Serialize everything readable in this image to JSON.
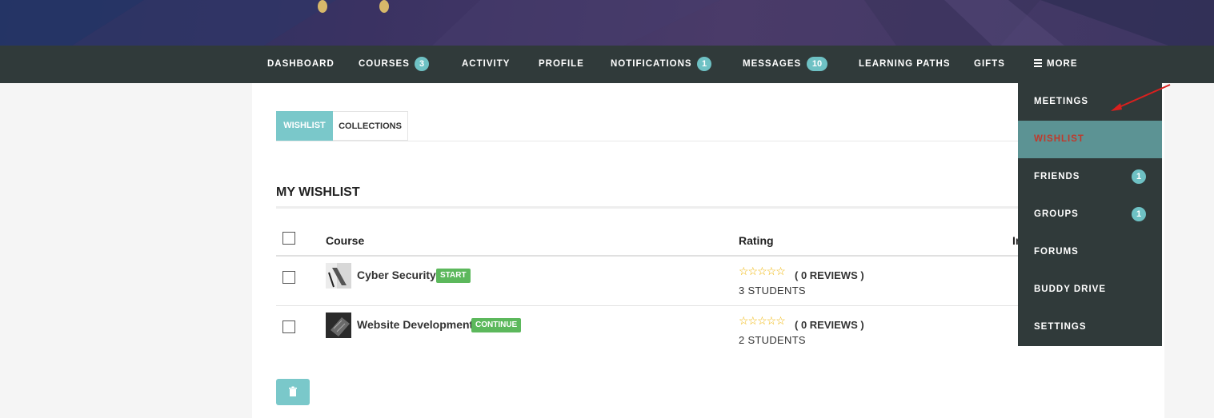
{
  "nav": {
    "items": [
      {
        "label": "DASHBOARD"
      },
      {
        "label": "COURSES",
        "badge": "3"
      },
      {
        "label": "ACTIVITY"
      },
      {
        "label": "PROFILE"
      },
      {
        "label": "NOTIFICATIONS",
        "badge": "1"
      },
      {
        "label": "MESSAGES",
        "badge": "10"
      },
      {
        "label": "LEARNING PATHS"
      },
      {
        "label": "GIFTS"
      },
      {
        "label": "MORE",
        "icon": "hamburger-icon"
      }
    ]
  },
  "dropdown": {
    "items": [
      {
        "label": "MEETINGS"
      },
      {
        "label": "WISHLIST",
        "active": true
      },
      {
        "label": "FRIENDS",
        "badge": "1"
      },
      {
        "label": "GROUPS",
        "badge": "1"
      },
      {
        "label": "FORUMS"
      },
      {
        "label": "BUDDY DRIVE"
      },
      {
        "label": "SETTINGS"
      }
    ]
  },
  "tabs": [
    {
      "label": "WISHLIST",
      "active": true
    },
    {
      "label": "COLLECTIONS",
      "active": false
    }
  ],
  "wishlist": {
    "title": "MY WISHLIST",
    "columns": {
      "course": "Course",
      "rating": "Rating",
      "instructor_fragment": "In"
    },
    "rows": [
      {
        "course": "Cyber Security",
        "status": "START",
        "stars": "☆☆☆☆☆",
        "reviews": "( 0 REVIEWS )",
        "students": "3 STUDENTS"
      },
      {
        "course": "Website Development",
        "status": "CONTINUE",
        "stars": "☆☆☆☆☆",
        "reviews": "( 0 REVIEWS )",
        "students": "2 STUDENTS"
      }
    ],
    "delete_icon": "trash-icon"
  },
  "colors": {
    "nav_bg": "#303a3a",
    "accent": "#7ac8ca",
    "badge": "#6ec1c4",
    "status_green": "#5cb85c",
    "active_text": "#c0392b",
    "star": "#f0b400",
    "annotation_arrow": "#d9201e"
  }
}
